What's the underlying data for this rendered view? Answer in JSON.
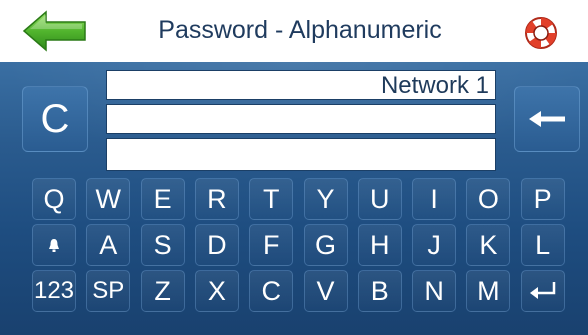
{
  "header": {
    "title": "Password - Alphanumeric",
    "back_icon": "green-left-arrow-icon",
    "help_icon": "lifebuoy-icon"
  },
  "fields": {
    "network_label": "Network 1",
    "line2_value": "",
    "line3_value": ""
  },
  "keys": {
    "clear": "C",
    "backspace_icon": "left-arrow-icon",
    "row1": [
      "Q",
      "W",
      "E",
      "R",
      "T",
      "Y",
      "U",
      "I",
      "O",
      "P"
    ],
    "row2": [
      "",
      "A",
      "S",
      "D",
      "F",
      "G",
      "H",
      "J",
      "K",
      "L"
    ],
    "row3": [
      "123",
      "SP",
      "Z",
      "X",
      "C",
      "V",
      "B",
      "N",
      "M",
      ""
    ],
    "shift_icon": "shift-bell-icon",
    "enter_icon": "enter-icon"
  },
  "colors": {
    "header_text": "#1f3b5e",
    "panel_top": "#3a6fa3",
    "panel_bottom": "#19416f",
    "back_arrow": "#58b83a"
  }
}
